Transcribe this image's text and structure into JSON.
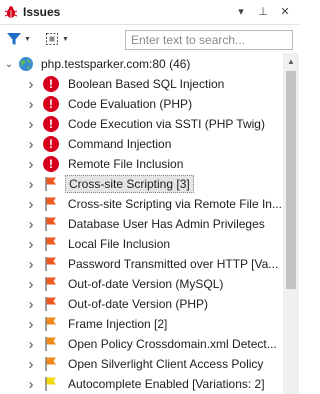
{
  "panel": {
    "title": "Issues",
    "controls": [
      {
        "name": "dropdown-icon",
        "glyph": "▾"
      },
      {
        "name": "pin-icon",
        "glyph": "⊥"
      },
      {
        "name": "close-icon",
        "glyph": "✕"
      }
    ]
  },
  "toolbar": {
    "search_placeholder": "Enter text to search..."
  },
  "colors": {
    "critical": "#d6001c",
    "high": "#ee5a24",
    "medium": "#f08a1c",
    "low": "#f5d90a",
    "filter": "#1e6fc6"
  },
  "tree": {
    "root": {
      "label": "php.testsparker.com:80 (46)",
      "icon": "globe-icon",
      "expanded": true
    },
    "items": [
      {
        "label": "Boolean Based SQL Injection",
        "severity": "critical"
      },
      {
        "label": "Code Evaluation (PHP)",
        "severity": "critical"
      },
      {
        "label": "Code Execution via SSTI (PHP Twig)",
        "severity": "critical"
      },
      {
        "label": "Command Injection",
        "severity": "critical"
      },
      {
        "label": "Remote File Inclusion",
        "severity": "critical"
      },
      {
        "label": "Cross-site Scripting [3]",
        "severity": "high",
        "selected": true
      },
      {
        "label": "Cross-site Scripting via Remote File In...",
        "severity": "high"
      },
      {
        "label": "Database User Has Admin Privileges",
        "severity": "high"
      },
      {
        "label": "Local File Inclusion",
        "severity": "high"
      },
      {
        "label": "Password Transmitted over HTTP [Va...",
        "severity": "high"
      },
      {
        "label": "Out-of-date Version (MySQL)",
        "severity": "high"
      },
      {
        "label": "Out-of-date Version (PHP)",
        "severity": "high"
      },
      {
        "label": "Frame Injection [2]",
        "severity": "medium"
      },
      {
        "label": "Open Policy Crossdomain.xml Detect...",
        "severity": "medium"
      },
      {
        "label": "Open Silverlight Client Access Policy",
        "severity": "medium"
      },
      {
        "label": "Autocomplete Enabled [Variations: 2]",
        "severity": "low"
      }
    ]
  }
}
